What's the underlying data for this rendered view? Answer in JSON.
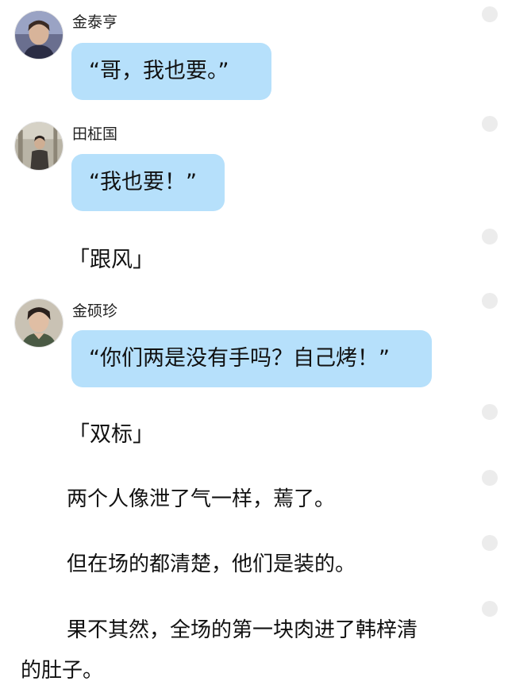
{
  "messages": [
    {
      "speaker": "金泰亨",
      "text": "“哥，我也要。”",
      "avatar": "avatar-taehyung"
    },
    {
      "speaker": "田柾国",
      "text": "“我也要！”",
      "avatar": "avatar-jungkook",
      "tag": "「跟风」"
    },
    {
      "speaker": "金硕珍",
      "text": "“你们两是没有手吗？自己烤！”",
      "avatar": "avatar-jin",
      "tag": "「双标」"
    }
  ],
  "narration": [
    "两个人像泄了气一样，蔫了。",
    "但在场的都清楚，他们是装的。",
    "果不其然，全场的第一块肉进了韩梓清",
    "的肚子。"
  ],
  "colors": {
    "bubble": "#b6e0fb",
    "dot": "#ececec",
    "text": "#111111"
  },
  "icons": {
    "comment_dot": "gray-circle-icon"
  }
}
